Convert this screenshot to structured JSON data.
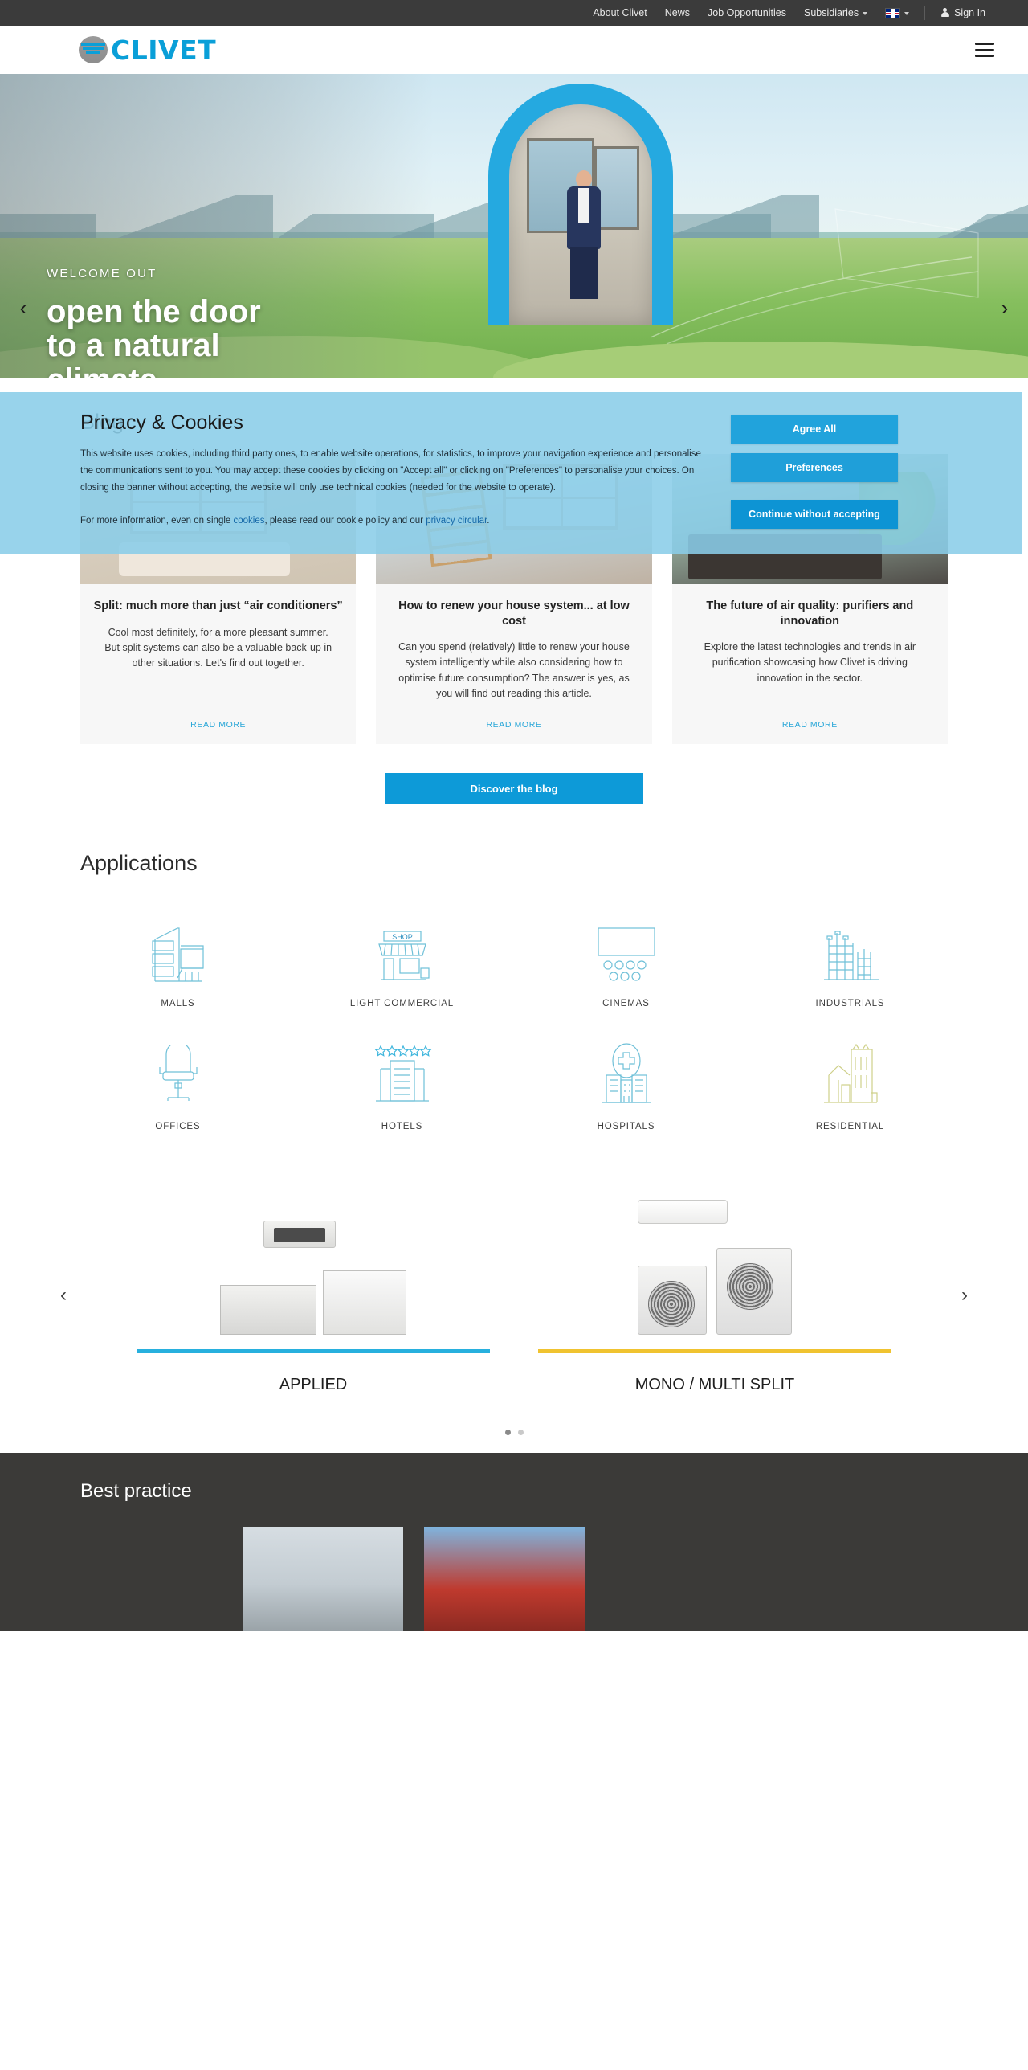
{
  "topbar": {
    "links": [
      {
        "label": "About Clivet",
        "has_caret": false
      },
      {
        "label": "News",
        "has_caret": false
      },
      {
        "label": "Job Opportunities",
        "has_caret": false
      },
      {
        "label": "Subsidiaries",
        "has_caret": true
      }
    ],
    "language": {
      "flag": "uk-flag-icon",
      "caret": true
    },
    "signin": "Sign In"
  },
  "header": {
    "logo_text": "CLIVET",
    "menu_icon": "hamburger-menu-icon"
  },
  "hero": {
    "kicker": "WELCOME OUT",
    "title_line1": "open the door",
    "title_line2": "to a natural",
    "title_line3": "climate",
    "prev_icon": "chevron-left-icon",
    "next_icon": "chevron-right-icon"
  },
  "cookie": {
    "title": "Privacy & Cookies",
    "paragraph1": "This website uses cookies, including third party ones, to enable website operations, for statistics, to improve your navigation experience and personalise the communications sent to you. You may accept these cookies by clicking on \"Accept all\" or clicking on \"Preferences\" to personalise your choices. On closing the banner without accepting, the website will only use technical cookies (needed for the website to operate).",
    "paragraph2_pre": "For more information, even on single ",
    "link_cookies": "cookies",
    "paragraph2_mid": ", please read our cookie policy and our ",
    "link_privacy": "privacy circular",
    "paragraph2_post": ".",
    "buttons": {
      "agree": "Agree All",
      "preferences": "Preferences",
      "continue": "Continue without accepting"
    },
    "accent_color": "#21a3dc"
  },
  "blog": {
    "title": "Blog",
    "cards": [
      {
        "image": "living-room-photo",
        "title": "Split: much more than just “air conditioners”",
        "text": "Cool most definitely, for a more pleasant summer. But split systems can also be a valuable back-up in other situations. Let's find out together.",
        "cta": "READ MORE"
      },
      {
        "image": "renovation-room-photo",
        "title": "How to renew your house system... at low cost",
        "text": "Can you spend (relatively) little to renew your house system intelligently while also considering how to optimise future consumption? The answer is yes, as you will find out reading this article.",
        "cta": "READ MORE"
      },
      {
        "image": "bedroom-sea-view-photo",
        "title": "The future of air quality: purifiers and innovation",
        "text": "Explore the latest technologies and trends in air purification showcasing how Clivet is driving innovation in the sector.",
        "cta": "READ MORE"
      }
    ],
    "discover_button": "Discover the blog"
  },
  "applications": {
    "title": "Applications",
    "items": [
      {
        "label": "MALLS",
        "icon": "mall-building-icon"
      },
      {
        "label": "LIGHT COMMERCIAL",
        "icon": "shop-storefront-icon"
      },
      {
        "label": "CINEMAS",
        "icon": "cinema-screen-icon"
      },
      {
        "label": "INDUSTRIALS",
        "icon": "factory-icon"
      },
      {
        "label": "OFFICES",
        "icon": "office-chair-icon"
      },
      {
        "label": "HOTELS",
        "icon": "hotel-five-star-icon"
      },
      {
        "label": "HOSPITALS",
        "icon": "hospital-cross-icon"
      },
      {
        "label": "RESIDENTIAL",
        "icon": "residential-house-icon"
      }
    ]
  },
  "products": {
    "prev_icon": "chevron-left-icon",
    "next_icon": "chevron-right-icon",
    "items": [
      {
        "name": "APPLIED",
        "underline_color": "#28b0de",
        "image": "applied-units-photo"
      },
      {
        "name": "MONO / MULTI SPLIT",
        "underline_color": "#f0c330",
        "image": "split-units-photo"
      }
    ],
    "dots": [
      {
        "active": true
      },
      {
        "active": false
      }
    ]
  },
  "best_practice": {
    "title": "Best practice",
    "cards": [
      {
        "image": "industrial-rooftop-photo"
      },
      {
        "image": "red-maple-building-photo"
      }
    ]
  }
}
